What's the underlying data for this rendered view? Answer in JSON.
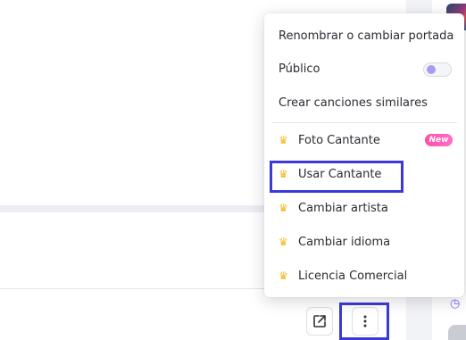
{
  "menu": {
    "items": [
      {
        "label": "Renombrar o cambiar portada",
        "premium": false
      },
      {
        "label": "Público",
        "premium": false,
        "toggle_on": false
      },
      {
        "label": "Crear canciones similares",
        "premium": false
      },
      {
        "label": "Foto Cantante",
        "premium": true,
        "badge": "New"
      },
      {
        "label": "Usar Cantante",
        "premium": true,
        "highlighted": true
      },
      {
        "label": "Cambiar artista",
        "premium": true
      },
      {
        "label": "Cambiar idioma",
        "premium": true
      },
      {
        "label": "Licencia Comercial",
        "premium": true
      }
    ]
  },
  "icons": {
    "premium": "crown-icon",
    "open_external": "open-external-icon",
    "more": "more-vertical-icon",
    "history": "clock-icon"
  },
  "colors": {
    "crown": "#f2b81d",
    "highlight_box": "#3b3ad6",
    "toggle_knob": "#a79cf2",
    "new_badge": "#ff4fa3"
  }
}
